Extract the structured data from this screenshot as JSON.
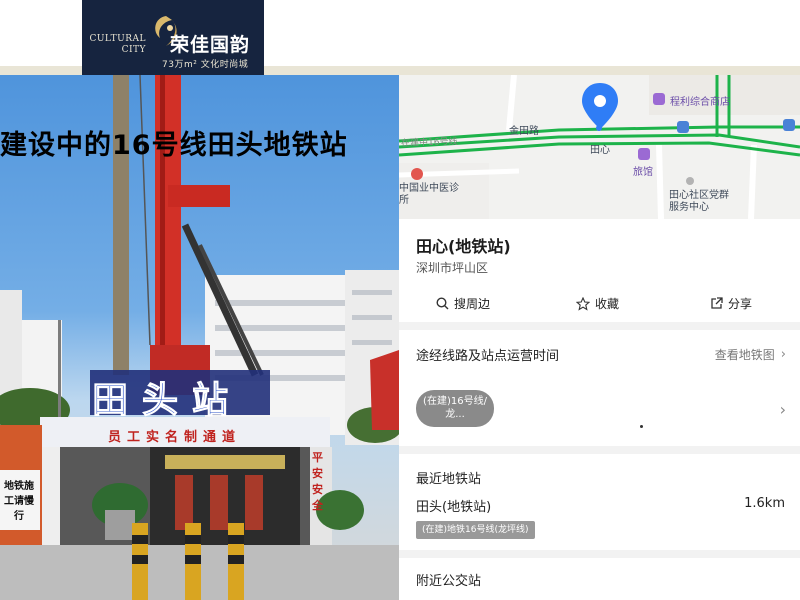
{
  "banner": {
    "logo_en": "CULTURAL CITY",
    "logo_cn": "荣佳国韵",
    "logo_sub": "73万m² 文化时尚城"
  },
  "photo": {
    "caption": "建设中的16号线田头地铁站",
    "sign_text": "田头站",
    "gate_banner": "员工实名制通道",
    "side_sign_left": "地铁施工请慢行",
    "side_sign_right": "平安安全"
  },
  "map": {
    "labels": {
      "road": "金田路",
      "line": "在建中16号线",
      "station": "田心",
      "shop": "程利综合商店",
      "hotel": "旅馆",
      "clinic": "中国业中医诊所",
      "community": "田心社区党群服务中心"
    },
    "colors": {
      "pin": "#2f7df6",
      "route": "#1db34a"
    }
  },
  "station": {
    "name": "田心(地铁站)",
    "district": "深圳市坪山区"
  },
  "actions": {
    "search": "搜周边",
    "favorite": "收藏",
    "share": "分享"
  },
  "routes": {
    "title": "途经线路及站点运营时间",
    "link": "查看地铁图",
    "chip": "(在建)16号线/龙..."
  },
  "nearest": {
    "title": "最近地铁站",
    "name": "田头(地铁站)",
    "distance": "1.6km",
    "badge": "(在建)地铁16号线(龙坪线)"
  },
  "bus": {
    "title": "附近公交站"
  }
}
